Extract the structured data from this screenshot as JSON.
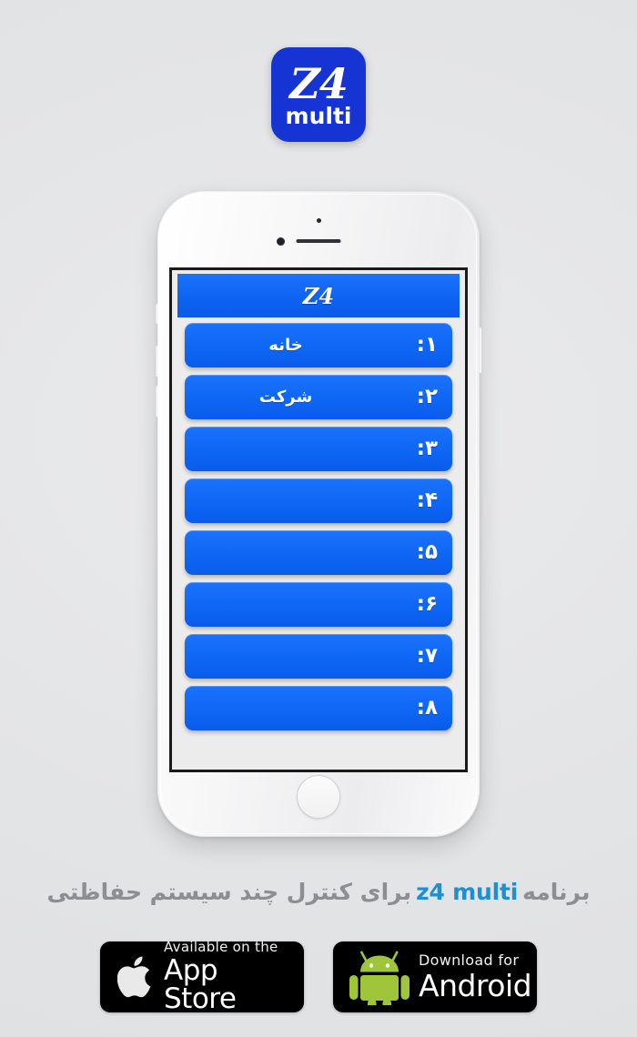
{
  "app": {
    "logo": {
      "line1": "Z4",
      "line2": "multi",
      "bg_color": "#1633d4",
      "text_color": "#ffffff"
    }
  },
  "phone": {
    "screen": {
      "header_title": "Z4",
      "header_color": "#0f63f2",
      "rows": [
        {
          "number": "۱:",
          "label": "خانه"
        },
        {
          "number": "۲:",
          "label": "شرکت"
        },
        {
          "number": "۳:",
          "label": ""
        },
        {
          "number": "۴:",
          "label": ""
        },
        {
          "number": "۵:",
          "label": ""
        },
        {
          "number": "۶:",
          "label": ""
        },
        {
          "number": "۷:",
          "label": ""
        },
        {
          "number": "۸:",
          "label": ""
        }
      ]
    }
  },
  "tagline": {
    "before": "برنامه",
    "brand": "z4 multi",
    "after": "برای کنترل چند سیستم حفاظتی",
    "text_color": "#8b8f93",
    "brand_color": "#1e8fd0"
  },
  "badges": {
    "apple": {
      "small": "Available on the",
      "big": "App Store",
      "icon": "apple-logo-icon"
    },
    "android": {
      "small": "Download for",
      "big": "Android",
      "icon": "android-robot-icon",
      "color": "#9fc63b"
    }
  }
}
